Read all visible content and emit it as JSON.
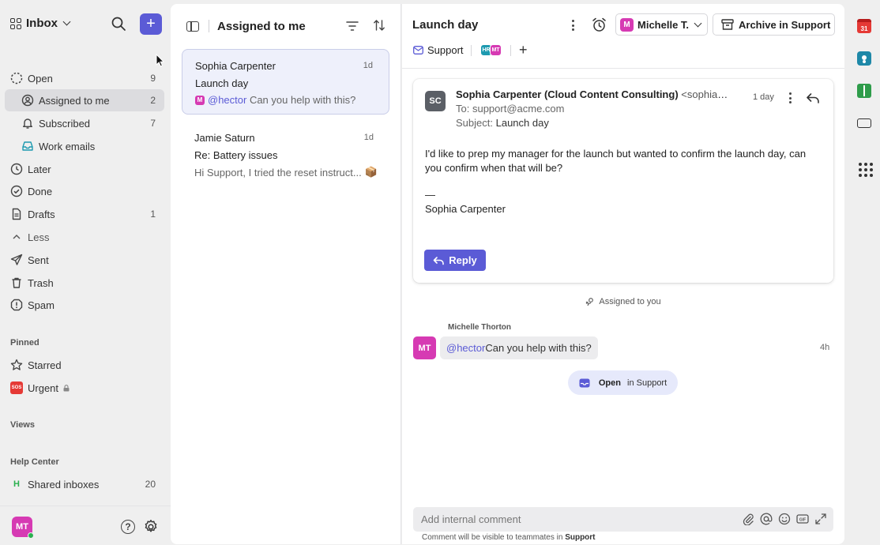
{
  "sidebar": {
    "workspace": "Inbox",
    "nav": [
      {
        "label": "Open",
        "count": "9",
        "icon": "open-circle-icon"
      },
      {
        "label": "Assigned to me",
        "count": "2",
        "icon": "person-icon",
        "active": true
      },
      {
        "label": "Subscribed",
        "count": "7",
        "icon": "bell-icon"
      },
      {
        "label": "Work emails",
        "count": "",
        "icon": "inbox-tray-icon"
      },
      {
        "label": "Later",
        "count": "",
        "icon": "clock-icon"
      },
      {
        "label": "Done",
        "count": "",
        "icon": "check-circle-icon"
      },
      {
        "label": "Drafts",
        "count": "1",
        "icon": "document-icon"
      },
      {
        "label": "Less",
        "count": "",
        "icon": "chevron-up-icon"
      },
      {
        "label": "Sent",
        "count": "",
        "icon": "send-icon"
      },
      {
        "label": "Trash",
        "count": "",
        "icon": "trash-icon"
      },
      {
        "label": "Spam",
        "count": "",
        "icon": "spam-icon"
      }
    ],
    "pinned_label": "Pinned",
    "pinned": [
      {
        "label": "Starred",
        "icon": "star-icon"
      },
      {
        "label": "Urgent",
        "icon": "sos-icon",
        "badge": "SOS"
      }
    ],
    "views_label": "Views",
    "help_center_label": "Help Center",
    "help_center": [
      {
        "label": "Shared inboxes",
        "count": "20",
        "badge": "H"
      }
    ],
    "me_initials": "MT"
  },
  "list": {
    "title": "Assigned to me",
    "conversations": [
      {
        "from": "Sophia Carpenter",
        "time": "1d",
        "subject": "Launch day",
        "mention": "@hector",
        "preview": " Can you help with this?",
        "badge": "M"
      },
      {
        "from": "Jamie Saturn",
        "time": "1d",
        "subject": "Re: Battery issues",
        "preview": "Hi Support, I tried the reset instruct...",
        "emoji": "📦"
      }
    ]
  },
  "conversation": {
    "title": "Launch day",
    "assignee": "Michelle T.",
    "assignee_badge": "M",
    "archive_label": "Archive in Support",
    "inbox": "Support",
    "participants": [
      "HR",
      "MT"
    ],
    "message": {
      "avatar": "SC",
      "sender_name": "Sophia Carpenter (Cloud Content Consulting)",
      "sender_email": "<sophia@...",
      "time": "1 day",
      "to_label": "To:",
      "to": "support@acme.com",
      "subject_label": "Subject:",
      "subject": "Launch day",
      "body": "I'd like to prep my manager for the launch but wanted to confirm the launch day, can you confirm when that will be?",
      "sig_dash": "—",
      "signature": "Sophia Carpenter",
      "reply_label": "Reply"
    },
    "assigned_event": "Assigned to you",
    "comment": {
      "author": "Michelle Thorton",
      "avatar": "MT",
      "mention": "@hector",
      "text": " Can you help with this?",
      "time": "4h"
    },
    "open_pill": {
      "bold": "Open",
      "rest": " in Support"
    },
    "composer": {
      "placeholder": "Add internal comment",
      "hint_prefix": "Comment will be visible to teammates in ",
      "hint_inbox": "Support"
    }
  },
  "rail": {
    "calendar_day": "31"
  },
  "colors": {
    "accent": "#5b5bd6",
    "magenta": "#d63ab3",
    "selected_bg": "#eef0fb"
  }
}
